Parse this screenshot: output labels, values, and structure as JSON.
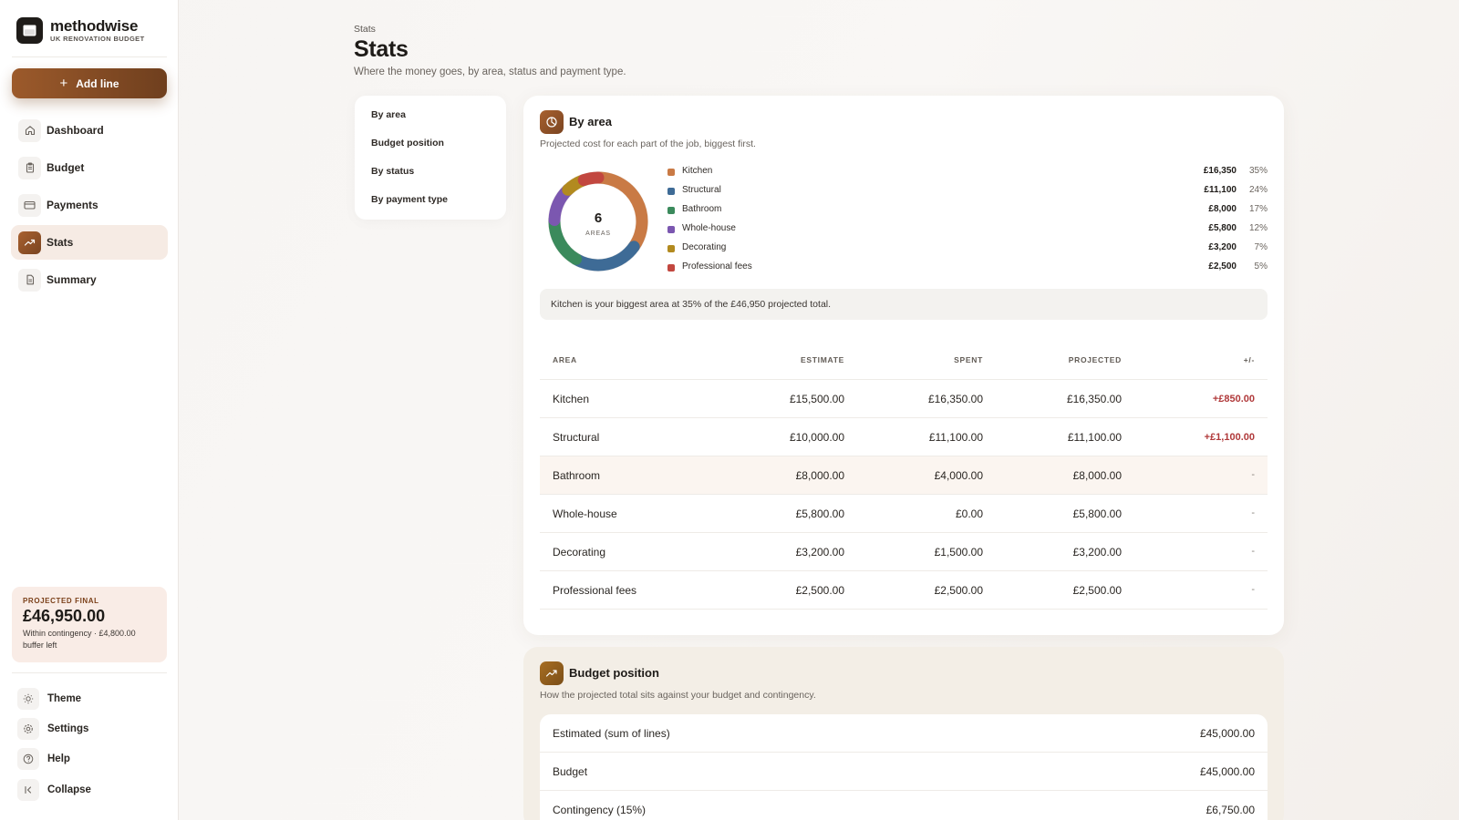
{
  "brand": {
    "name": "methodwise",
    "subtitle": "UK RENOVATION BUDGET"
  },
  "sidebar": {
    "add_label": "Add line",
    "nav": [
      {
        "label": "Dashboard",
        "icon": "home-icon"
      },
      {
        "label": "Budget",
        "icon": "clipboard-icon"
      },
      {
        "label": "Payments",
        "icon": "card-icon"
      },
      {
        "label": "Stats",
        "icon": "trending-icon",
        "active": true
      },
      {
        "label": "Summary",
        "icon": "document-icon"
      }
    ],
    "projected": {
      "label": "PROJECTED FINAL",
      "value": "£46,950.00",
      "note": "Within contingency · £4,800.00 buffer left"
    },
    "utility": [
      {
        "label": "Theme",
        "icon": "sun-icon"
      },
      {
        "label": "Settings",
        "icon": "gear-icon"
      },
      {
        "label": "Help",
        "icon": "help-icon"
      },
      {
        "label": "Collapse",
        "icon": "collapse-icon"
      }
    ]
  },
  "header": {
    "breadcrumb": "Stats",
    "title": "Stats",
    "subtitle": "Where the money goes, by area, status and payment type."
  },
  "section_nav": [
    "By area",
    "Budget position",
    "By status",
    "By payment type"
  ],
  "by_area": {
    "title": "By area",
    "subtitle": "Projected cost for each part of the job, biggest first.",
    "donut_count": "6",
    "donut_label": "AREAS",
    "insight": "Kitchen is your biggest area at 35% of the £46,950 projected total.",
    "legend": [
      {
        "name": "Kitchen",
        "value": "£16,350",
        "pct": "35%",
        "color": "#c97a45"
      },
      {
        "name": "Structural",
        "value": "£11,100",
        "pct": "24%",
        "color": "#3e6b96"
      },
      {
        "name": "Bathroom",
        "value": "£8,000",
        "pct": "17%",
        "color": "#3b8a5c"
      },
      {
        "name": "Whole-house",
        "value": "£5,800",
        "pct": "12%",
        "color": "#7b57b0"
      },
      {
        "name": "Decorating",
        "value": "£3,200",
        "pct": "7%",
        "color": "#b28a1f"
      },
      {
        "name": "Professional fees",
        "value": "£2,500",
        "pct": "5%",
        "color": "#c2473f"
      }
    ],
    "columns": [
      "AREA",
      "ESTIMATE",
      "SPENT",
      "PROJECTED",
      "+/-"
    ],
    "rows": [
      {
        "area": "Kitchen",
        "estimate": "£15,500.00",
        "spent": "£16,350.00",
        "projected": "£16,350.00",
        "diff": "+£850.00",
        "over": true
      },
      {
        "area": "Structural",
        "estimate": "£10,000.00",
        "spent": "£11,100.00",
        "projected": "£11,100.00",
        "diff": "+£1,100.00",
        "over": true
      },
      {
        "area": "Bathroom",
        "estimate": "£8,000.00",
        "spent": "£4,000.00",
        "projected": "£8,000.00",
        "diff": "-",
        "over": false
      },
      {
        "area": "Whole-house",
        "estimate": "£5,800.00",
        "spent": "£0.00",
        "projected": "£5,800.00",
        "diff": "-",
        "over": false
      },
      {
        "area": "Decorating",
        "estimate": "£3,200.00",
        "spent": "£1,500.00",
        "projected": "£3,200.00",
        "diff": "-",
        "over": false
      },
      {
        "area": "Professional fees",
        "estimate": "£2,500.00",
        "spent": "£2,500.00",
        "projected": "£2,500.00",
        "diff": "-",
        "over": false
      }
    ]
  },
  "budget_position": {
    "title": "Budget position",
    "subtitle": "How the projected total sits against your budget and contingency.",
    "rows": [
      {
        "label": "Estimated (sum of lines)",
        "value": "£45,000.00"
      },
      {
        "label": "Budget",
        "value": "£45,000.00"
      },
      {
        "label": "Contingency (15%)",
        "value": "£6,750.00"
      }
    ]
  },
  "colors": {
    "accent": "#9c5a2b",
    "over_budget": "#b0393a"
  },
  "chart_data": {
    "type": "pie",
    "categories": [
      "Kitchen",
      "Structural",
      "Bathroom",
      "Whole-house",
      "Decorating",
      "Professional fees"
    ],
    "values": [
      16350,
      11100,
      8000,
      5800,
      3200,
      2500
    ],
    "title": "By area"
  }
}
